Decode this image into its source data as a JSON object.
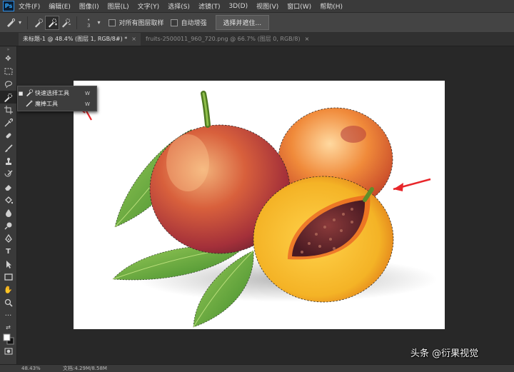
{
  "app": {
    "logo": "Ps"
  },
  "menubar": {
    "items": [
      "文件(F)",
      "编辑(E)",
      "图像(I)",
      "图层(L)",
      "文字(Y)",
      "选择(S)",
      "滤镜(T)",
      "3D(D)",
      "视图(V)",
      "窗口(W)",
      "帮助(H)"
    ]
  },
  "options": {
    "brush_size": "3",
    "sample_all_layers": "对所有图层取样",
    "auto_enhance": "自动增强",
    "select_and_mask": "选择并遮住..."
  },
  "tabs": [
    {
      "label": "未标题-1 @ 48.4% (图层 1, RGB/8#) *",
      "active": true
    },
    {
      "label": "fruits-2500011_960_720.png @ 66.7% (图层 0, RGB/8)",
      "active": false
    }
  ],
  "tools": [
    "move-tool",
    "marquee-tool",
    "lasso-tool",
    "quick-selection-tool",
    "crop-tool",
    "eyedropper-tool",
    "healing-brush-tool",
    "brush-tool",
    "clone-stamp-tool",
    "history-brush-tool",
    "eraser-tool",
    "paint-bucket-tool",
    "blur-tool",
    "dodge-tool",
    "pen-tool",
    "type-tool",
    "path-selection-tool",
    "rectangle-tool",
    "hand-tool",
    "zoom-tool",
    "more-tools"
  ],
  "flyout": {
    "items": [
      {
        "label": "快速选择工具",
        "key": "W",
        "selected": true
      },
      {
        "label": "魔棒工具",
        "key": "W",
        "selected": false
      }
    ]
  },
  "status": {
    "zoom": "48.43%",
    "doc_size": "文档:4.29M/8.58M"
  },
  "watermark": "头条 @衍果视觉",
  "colors": {
    "annotation_red": "#e8262a",
    "ui_dark": "#282828",
    "panel": "#3a3a3a"
  }
}
